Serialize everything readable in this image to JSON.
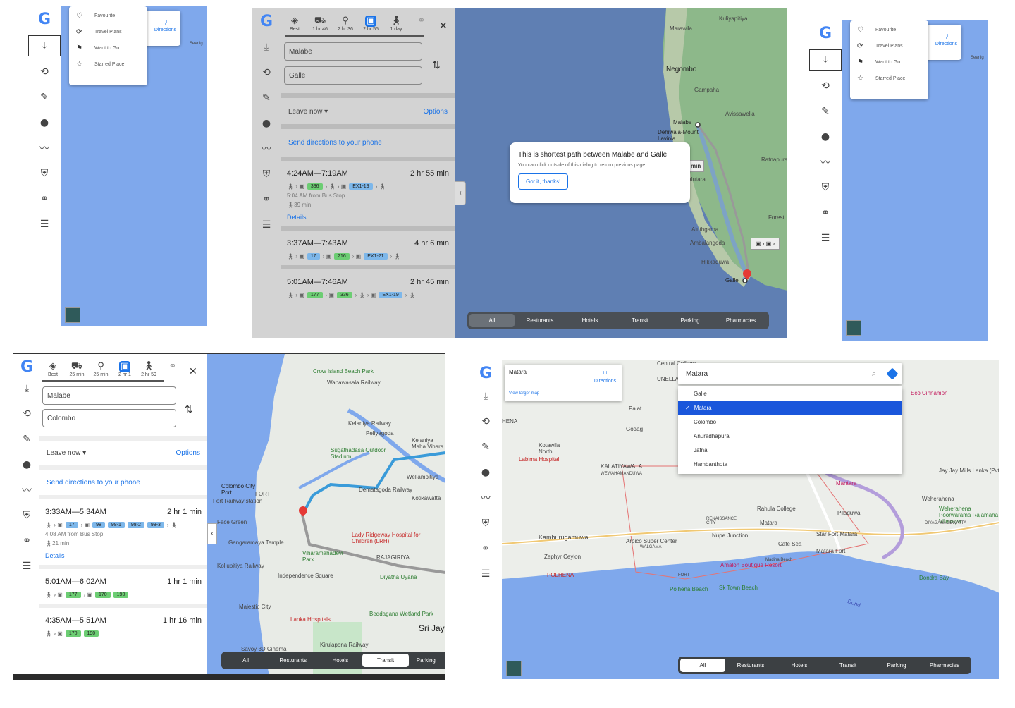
{
  "colors": {
    "accent": "#1a73e8",
    "sea": "#7fa8ec",
    "route_green": "#6ccd73",
    "route_blue": "#7db7ea"
  },
  "rail_icons": [
    "download-icon",
    "history-icon",
    "feedback-icon",
    "person-pin-icon",
    "trend-icon",
    "shield-icon",
    "link-icon",
    "list-arrow-icon"
  ],
  "saved_menu": {
    "items": [
      {
        "icon": "heart-icon",
        "label": "Favourite"
      },
      {
        "icon": "travel-icon",
        "label": "Travel Plans"
      },
      {
        "icon": "flag-icon",
        "label": "Want to Go"
      },
      {
        "icon": "star-icon",
        "label": "Starred Place"
      }
    ],
    "directions_label": "Directions",
    "map_label": "Seenig"
  },
  "p2": {
    "modes": [
      {
        "icon": "best-icon",
        "label": "Best"
      },
      {
        "icon": "car-icon",
        "label": "1 hr 46"
      },
      {
        "icon": "motorbike-icon",
        "label": "2 hr 36"
      },
      {
        "icon": "bus-icon",
        "label": "2 hr 55",
        "selected": true
      },
      {
        "icon": "walk-icon",
        "label": "1 day"
      },
      {
        "icon": "bike-icon",
        "label": ""
      }
    ],
    "from": "Malabe",
    "to": "Galle",
    "leave": "Leave now",
    "options": "Options",
    "send": "Send directions to your phone",
    "routes": [
      {
        "time": "4:24AM—7:19AM",
        "dur": "2 hr 55 min",
        "badges": [
          {
            "t": "336",
            "c": "g"
          },
          {
            "t": "EX1-19",
            "c": "b"
          }
        ],
        "sub": "5:04 AM from Bus Stop",
        "walk": "39 min",
        "details": "Details"
      },
      {
        "time": "3:37AM—7:43AM",
        "dur": "4 hr 6 min",
        "badges": [
          {
            "t": "17",
            "c": "b"
          },
          {
            "t": "216",
            "c": "g"
          },
          {
            "t": "EX1-21",
            "c": "b"
          }
        ]
      },
      {
        "time": "5:01AM—7:46AM",
        "dur": "2 hr 45 min",
        "badges": [
          {
            "t": "177",
            "c": "g"
          },
          {
            "t": "336",
            "c": "g"
          },
          {
            "t": "EX1-19",
            "c": "b"
          }
        ]
      }
    ],
    "dialog": {
      "title": "This is shortest path between Malabe and Galle",
      "body": "You can click outside of this dialog to return previous page.",
      "button": "Got it, thanks!"
    },
    "places": [
      "Marawila",
      "Kuliyapitiya",
      "Negombo",
      "Gampaha",
      "Avissawella",
      "Malabe",
      "Dehiwala-Mount Lavinia",
      "Kalutara",
      "Ratnapura",
      "Aluthgama",
      "Ambalangoda",
      "Hikkaduwa",
      "Galle",
      "Forest"
    ],
    "route_chip": "min"
  },
  "categories": [
    "All",
    "Resturants",
    "Hotels",
    "Transit",
    "Parking",
    "Pharmacies"
  ],
  "p4": {
    "modes": [
      {
        "icon": "best-icon",
        "label": "Best"
      },
      {
        "icon": "car-icon",
        "label": "25 min"
      },
      {
        "icon": "motorbike-icon",
        "label": "25 min"
      },
      {
        "icon": "bus-icon",
        "label": "2 hr 1",
        "selected": true
      },
      {
        "icon": "walk-icon",
        "label": "2 hr 59"
      },
      {
        "icon": "bike-icon",
        "label": ""
      }
    ],
    "from": "Malabe",
    "to": "Colombo",
    "leave": "Leave now",
    "options": "Options",
    "send": "Send directions to your phone",
    "routes": [
      {
        "time": "3:33AM—5:34AM",
        "dur": "2 hr 1 min",
        "badges": [
          {
            "t": "17",
            "c": "b"
          },
          {
            "t": "98",
            "c": "b"
          },
          {
            "t": "98-1",
            "c": "b"
          },
          {
            "t": "98-2",
            "c": "b"
          },
          {
            "t": "98-3",
            "c": "b"
          }
        ],
        "sub": "4:08 AM from Bus Stop",
        "walk": "21 min",
        "details": "Details"
      },
      {
        "time": "5:01AM—6:02AM",
        "dur": "1 hr 1 min",
        "badges": [
          {
            "t": "177",
            "c": "g"
          },
          {
            "t": "170",
            "c": "g"
          },
          {
            "t": "190",
            "c": "g"
          }
        ]
      },
      {
        "time": "4:35AM—5:51AM",
        "dur": "1 hr 16 min",
        "badges": [
          {
            "t": "170",
            "c": "g"
          },
          {
            "t": "190",
            "c": "g"
          }
        ]
      }
    ],
    "places": [
      "Crow Island Beach Park",
      "Wanawasala Railway",
      "Peliyagoda",
      "Kelaniya Railway",
      "Kelaniya Maha Vihara",
      "Sugathadasa Outdoor Stadium",
      "Wellampitiya",
      "Dematagoda Railway",
      "Kotikawatta",
      "Colombo City Port",
      "FORT",
      "Fort Railway station",
      "Face Green",
      "Gangaramaya Temple",
      "Lady Ridgeway Hospital for Children (LRH)",
      "RAJAGIRIYA",
      "Viharamahadevi Park",
      "Independence Square",
      "Diyatha Uyana",
      "Kollupitiya Railway",
      "Majestic City",
      "Lanka Hospitals",
      "Beddagana Wetland Park",
      "Sri Jay",
      "Savoy 3D Cinema",
      "Kirulapona Railway"
    ]
  },
  "p5": {
    "card_title": "Matara",
    "view_larger": "View larger map",
    "directions": "Directions",
    "search_value": "Matara",
    "options": [
      "Galle",
      "Matara",
      "Colombo",
      "Anuradhapura",
      "Jafna",
      "Hambanthota"
    ],
    "selected": "Matara",
    "places": [
      "Central College",
      "UNELLA",
      "Palat",
      "Godag",
      "HENA",
      "Kotawila North",
      "Labima Hospital",
      "KALATIYAWALA",
      "WEWAHAMANDUWA",
      "Eco Cinnamon",
      "Jay Jay Mills Lanka (Pvt)",
      "Mantara",
      "Weherahena",
      "Weherahena Poorwarama Rajamaha Viharaya",
      "DIYAGAHAGEWATTA",
      "Rahula College",
      "Piladuwa",
      "RENAISSANCE CITY",
      "Matara",
      "Nupe Junction",
      "Star Fort Matara",
      "Kamburugamuwa",
      "Arpico Super Center",
      "Matara Fort",
      "WALGAMA",
      "Cafe Sea",
      "Amaloh Boutique Resort",
      "Zephyr Ceylon",
      "POLHENA",
      "FORT",
      "Madiha Beach",
      "Polhena Beach",
      "Sk Town Beach",
      "Dondra Bay",
      "Dond"
    ]
  }
}
